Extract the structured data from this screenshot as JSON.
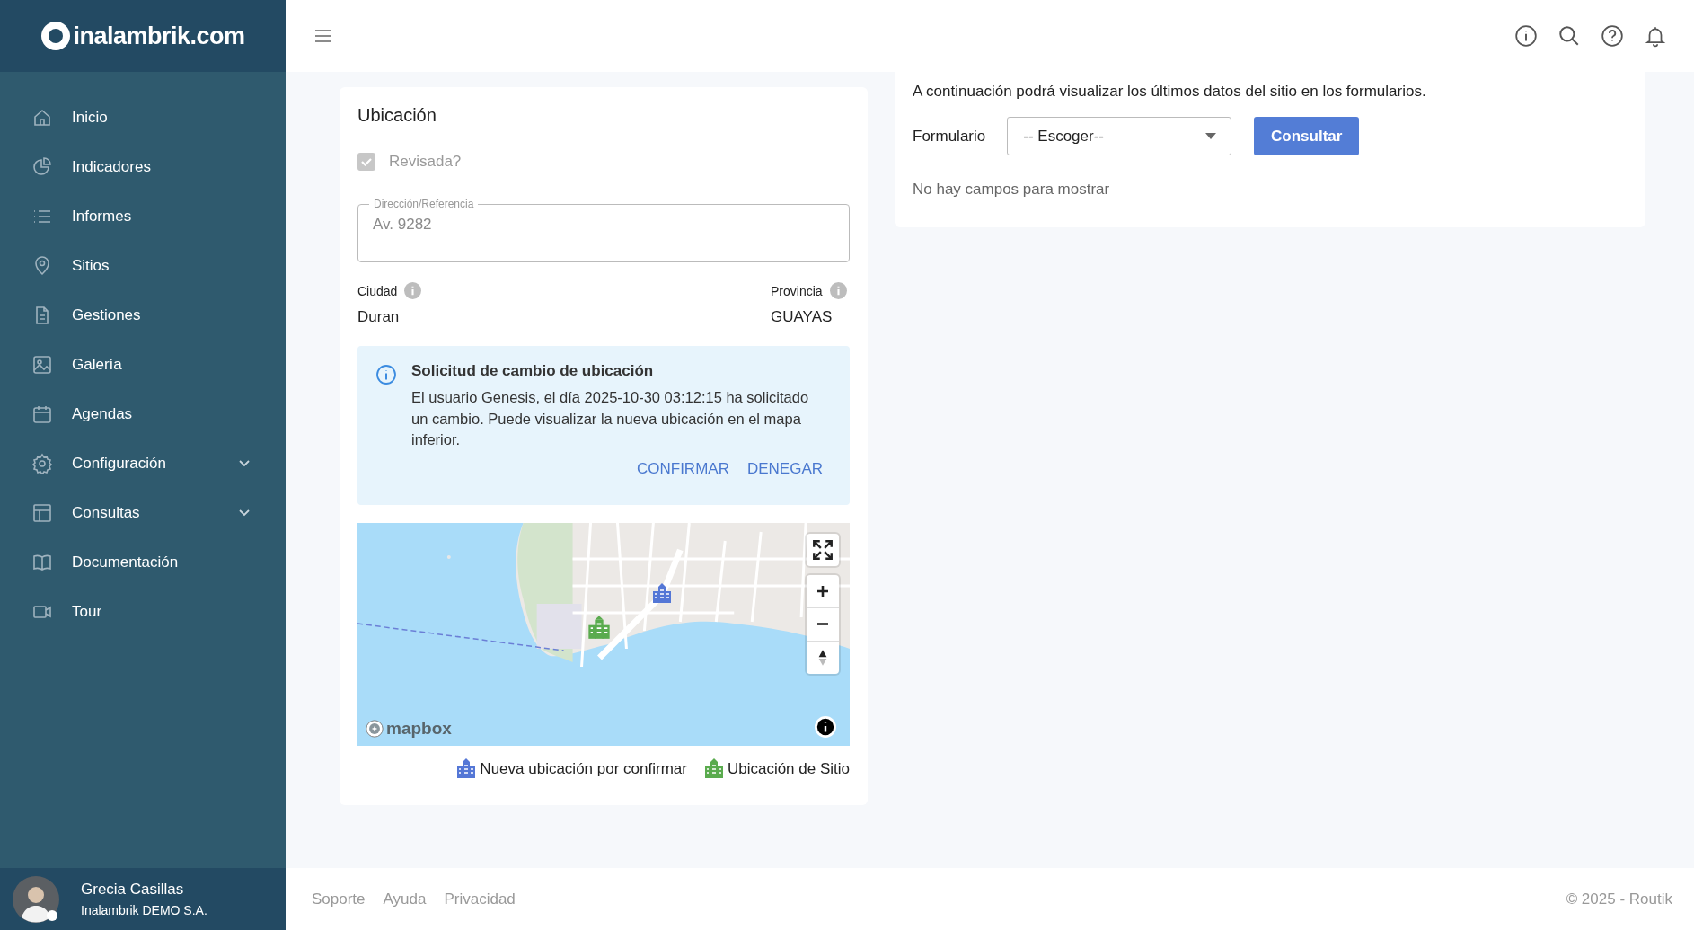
{
  "sidebar": {
    "logo": "inalambrik.com",
    "items": [
      {
        "label": "Inicio",
        "kind": "link"
      },
      {
        "label": "Indicadores",
        "kind": "link"
      },
      {
        "label": "Informes",
        "kind": "link"
      },
      {
        "label": "Sitios",
        "kind": "link"
      },
      {
        "label": "Gestiones",
        "kind": "link"
      },
      {
        "label": "Galería",
        "kind": "link"
      },
      {
        "label": "Agendas",
        "kind": "link"
      },
      {
        "label": "Configuración",
        "kind": "group",
        "expanded": false
      },
      {
        "label": "Consultas",
        "kind": "group",
        "expanded": false
      },
      {
        "label": "Documentación",
        "kind": "link"
      },
      {
        "label": "Tour",
        "kind": "link"
      }
    ],
    "user": {
      "name": "Grecia Casillas",
      "company": "Inalambrik DEMO S.A."
    }
  },
  "location_card": {
    "title": "Ubicación",
    "reviewed": {
      "label": "Revisada?",
      "checked": true,
      "disabled": true
    },
    "address": {
      "label": "Dirección/Referencia",
      "value": "Av. 9282"
    },
    "city": {
      "label": "Ciudad",
      "value": "Duran"
    },
    "province": {
      "label": "Provincia",
      "value": "GUAYAS"
    },
    "alert": {
      "title": "Solicitud de cambio de ubicación",
      "text": "El usuario Genesis, el día 2025-10-30 03:12:15 ha solicitado un cambio. Puede visualizar la nueva ubicación en el mapa inferior.",
      "actions": [
        "CONFIRMAR",
        "DENEGAR"
      ]
    },
    "map": {
      "attribution": "mapbox",
      "markers": [
        {
          "color": "#5477d6"
        },
        {
          "color": "#5aab4e"
        }
      ]
    },
    "legend": [
      {
        "label": "Nueva ubicación por confirmar",
        "color": "#5477d6"
      },
      {
        "label": "Ubicación de Sitio",
        "color": "#5aab4e"
      }
    ]
  },
  "forms_card": {
    "intro": "A continuación podrá visualizar los últimos datos del sitio en los formularios.",
    "field_label": "Formulario",
    "select_value": "-- Escoger--",
    "button": "Consultar",
    "empty": "No hay campos para mostrar"
  },
  "footer": {
    "links": [
      "Soporte",
      "Ayuda",
      "Privacidad"
    ],
    "copyright": "© 2025 - Routik"
  }
}
